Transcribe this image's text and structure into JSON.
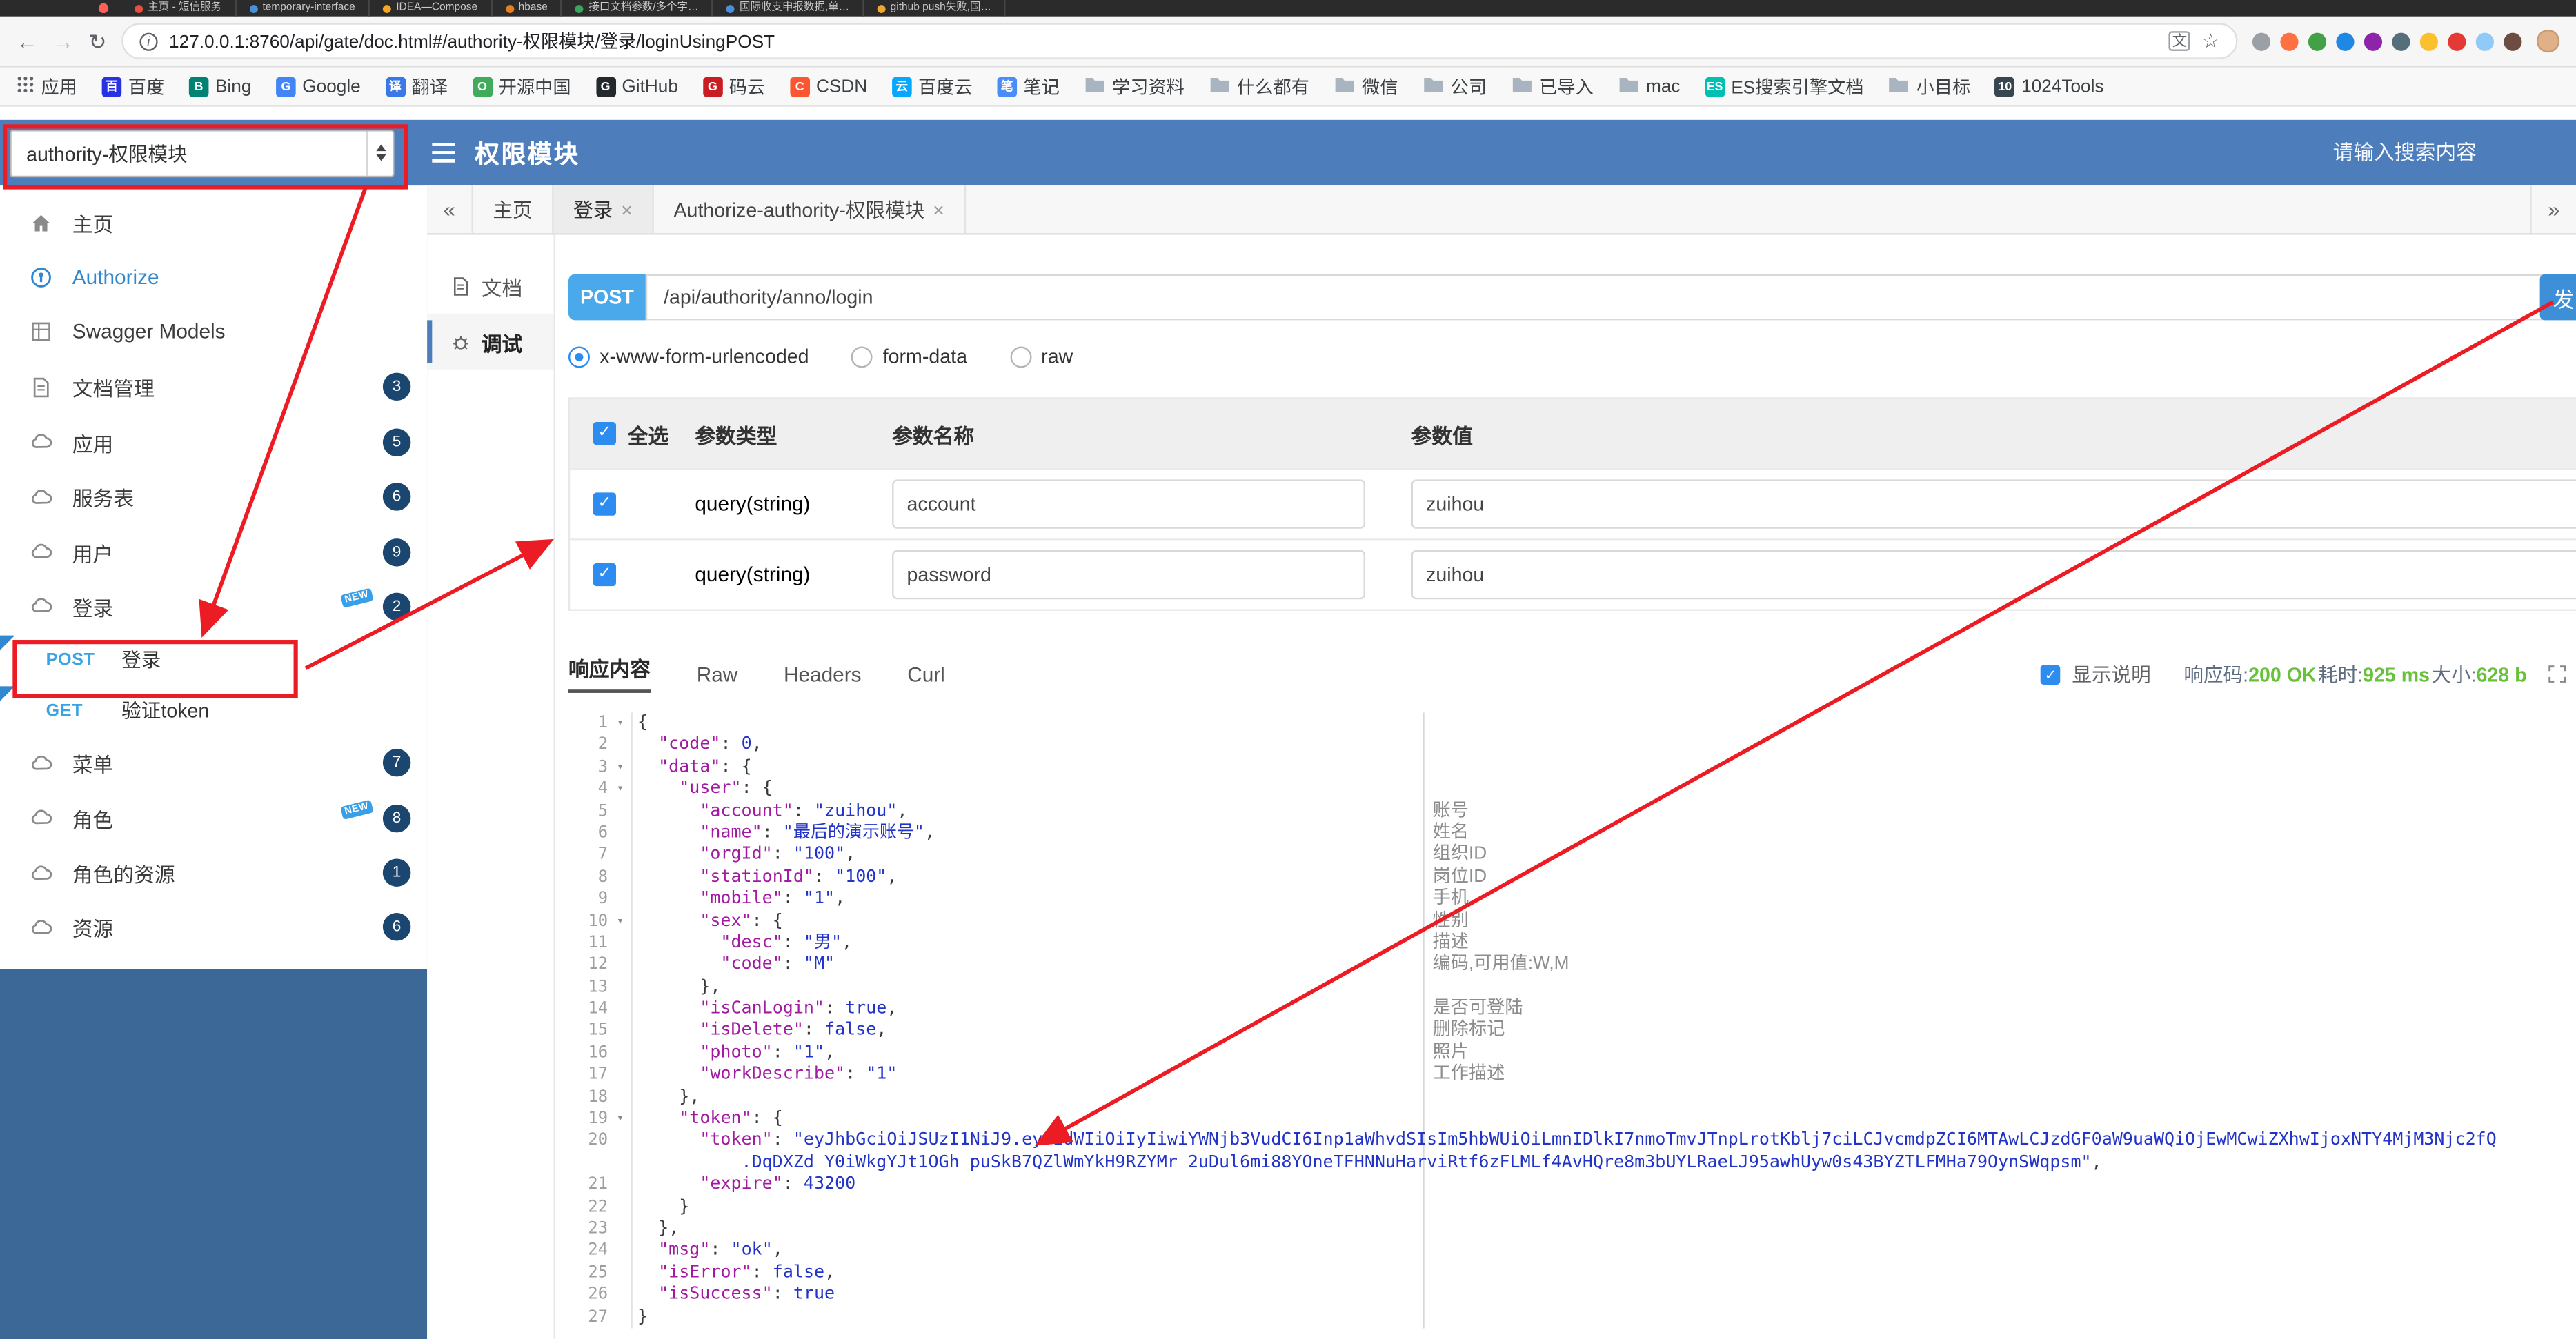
{
  "colors": {
    "header_blue": "#4d7ebb",
    "sidebar_bottom_blue": "#3c6897",
    "accent_blue": "#2d8cf0",
    "method_blue": "#4aa9ea",
    "badge_navy": "#1a466f",
    "success_green": "#67c23a",
    "annotation_red": "#ec1c24"
  },
  "browser": {
    "tabs": [
      {
        "title": "主页 - 短信服务",
        "color": "#e84d3d"
      },
      {
        "title": "temporary-interface",
        "color": "#4a90d9"
      },
      {
        "title": "IDEA—Compose",
        "color": "#f5a623"
      },
      {
        "title": "hbase",
        "color": "#e67e22"
      },
      {
        "title": "接口文档参数/多个字…",
        "color": "#3ba55d"
      },
      {
        "title": "国际收支申报数据,单…",
        "color": "#4a90d9"
      },
      {
        "title": "github push失败,国…",
        "color": "#f0a732"
      }
    ],
    "toolbar": {
      "url": "127.0.0.1:8760/api/gate/doc.html#/authority-权限模块/登录/loginUsingPOST",
      "extension_icons": [
        "#9aa0a6",
        "#ff7043",
        "#43a047",
        "#1e88e5",
        "#8e24aa",
        "#546e7a",
        "#fbc02d",
        "#e53935",
        "#90caf9",
        "#6d4c41"
      ],
      "avatar_color": "#e0b089"
    },
    "bookmarks": [
      {
        "label": "应用",
        "icon": "apps"
      },
      {
        "label": "百度",
        "icon": "letter",
        "letter": "百",
        "color": "#2932e1"
      },
      {
        "label": "Bing",
        "icon": "letter",
        "letter": "B",
        "color": "#008373"
      },
      {
        "label": "Google",
        "icon": "letter",
        "letter": "G",
        "color": "#4285f4"
      },
      {
        "label": "翻译",
        "icon": "letter",
        "letter": "译",
        "color": "#3b78e7"
      },
      {
        "label": "开源中国",
        "icon": "letter",
        "letter": "O",
        "color": "#41ab5d"
      },
      {
        "label": "GitHub",
        "icon": "letter",
        "letter": "G",
        "color": "#24292e"
      },
      {
        "label": "码云",
        "icon": "letter",
        "letter": "G",
        "color": "#c71d23"
      },
      {
        "label": "CSDN",
        "icon": "letter",
        "letter": "C",
        "color": "#fc5531"
      },
      {
        "label": "百度云",
        "icon": "letter",
        "letter": "云",
        "color": "#06a7ff"
      },
      {
        "label": "笔记",
        "icon": "letter",
        "letter": "笔",
        "color": "#4b8df8"
      },
      {
        "label": "学习资料",
        "icon": "folder"
      },
      {
        "label": "什么都有",
        "icon": "folder"
      },
      {
        "label": "微信",
        "icon": "folder"
      },
      {
        "label": "公司",
        "icon": "folder"
      },
      {
        "label": "已导入",
        "icon": "folder"
      },
      {
        "label": "mac",
        "icon": "folder"
      },
      {
        "label": "ES搜索引擎文档",
        "icon": "letter",
        "letter": "ES",
        "color": "#00bfb3"
      },
      {
        "label": "小目标",
        "icon": "folder"
      },
      {
        "label": "1024Tools",
        "icon": "letter",
        "letter": "10",
        "color": "#37474f"
      }
    ]
  },
  "header": {
    "module_select_value": "authority-权限模块",
    "title": "权限模块",
    "search_placeholder": "请输入搜索内容"
  },
  "sidebar": {
    "items": [
      {
        "label": "主页",
        "icon": "home"
      },
      {
        "label": "Authorize",
        "icon": "auth",
        "active": true
      },
      {
        "label": "Swagger Models",
        "icon": "models"
      },
      {
        "label": "文档管理",
        "icon": "doc",
        "badge": "3"
      },
      {
        "label": "应用",
        "icon": "cloud",
        "badge": "5"
      },
      {
        "label": "服务表",
        "icon": "cloud",
        "badge": "6"
      },
      {
        "label": "用户",
        "icon": "cloud",
        "badge": "9"
      },
      {
        "label": "登录",
        "icon": "cloud",
        "badge": "2",
        "is_new": true,
        "children": [
          {
            "method": "POST",
            "label": "登录",
            "highlighted": true
          },
          {
            "method": "GET",
            "label": "验证token"
          }
        ]
      },
      {
        "label": "菜单",
        "icon": "cloud",
        "badge": "7"
      },
      {
        "label": "角色",
        "icon": "cloud",
        "badge": "8",
        "is_new": true
      },
      {
        "label": "角色的资源",
        "icon": "cloud",
        "badge": "1"
      },
      {
        "label": "资源",
        "icon": "cloud",
        "badge": "6"
      }
    ]
  },
  "doc_tabs": {
    "collapse_label": "«",
    "more_label": "»",
    "tabs": [
      {
        "label": "主页",
        "closable": false,
        "active": false
      },
      {
        "label": "登录",
        "closable": true,
        "active": true
      },
      {
        "label": "Authorize-authority-权限模块",
        "closable": true,
        "active": false
      }
    ]
  },
  "vertical_tabs": [
    {
      "label": "文档",
      "active": false
    },
    {
      "label": "调试",
      "active": true
    }
  ],
  "request": {
    "method": "POST",
    "path": "/api/authority/anno/login",
    "send_label": "发送",
    "body_types": [
      {
        "label": "x-www-form-urlencoded",
        "checked": true
      },
      {
        "label": "form-data",
        "checked": false
      },
      {
        "label": "raw",
        "checked": false
      }
    ]
  },
  "params_table": {
    "headers": [
      "全选",
      "参数类型",
      "参数名称",
      "参数值"
    ],
    "rows": [
      {
        "checked": true,
        "type": "query(string)",
        "name": "account",
        "value": "zuihou"
      },
      {
        "checked": true,
        "type": "query(string)",
        "name": "password",
        "value": "zuihou"
      }
    ]
  },
  "response": {
    "tabs": [
      {
        "label": "响应内容",
        "active": true
      },
      {
        "label": "Raw",
        "active": false
      },
      {
        "label": "Headers",
        "active": false
      },
      {
        "label": "Curl",
        "active": false
      }
    ],
    "show_desc_label": "显示说明",
    "show_desc_checked": true,
    "status": [
      {
        "label": "响应码:",
        "value": "200 OK"
      },
      {
        "label": "耗时:",
        "value": "925 ms"
      },
      {
        "label": "大小:",
        "value": "628 b"
      }
    ]
  },
  "code": {
    "rows": [
      {
        "n": "1",
        "fold": true,
        "seg": [
          [
            "pun",
            "{"
          ]
        ]
      },
      {
        "n": "2",
        "seg": [
          [
            "pun",
            "  "
          ],
          [
            "key",
            "\"code\""
          ],
          [
            "pun",
            ": "
          ],
          [
            "num",
            "0"
          ],
          [
            "pun",
            ","
          ]
        ]
      },
      {
        "n": "3",
        "fold": true,
        "seg": [
          [
            "pun",
            "  "
          ],
          [
            "key",
            "\"data\""
          ],
          [
            "pun",
            ": {"
          ]
        ]
      },
      {
        "n": "4",
        "fold": true,
        "seg": [
          [
            "pun",
            "    "
          ],
          [
            "key",
            "\"user\""
          ],
          [
            "pun",
            ": {"
          ]
        ]
      },
      {
        "n": "5",
        "ann": "账号",
        "seg": [
          [
            "pun",
            "      "
          ],
          [
            "key",
            "\"account\""
          ],
          [
            "pun",
            ": "
          ],
          [
            "str",
            "\"zuihou\""
          ],
          [
            "pun",
            ","
          ]
        ]
      },
      {
        "n": "6",
        "ann": "姓名",
        "seg": [
          [
            "pun",
            "      "
          ],
          [
            "key",
            "\"name\""
          ],
          [
            "pun",
            ": "
          ],
          [
            "str",
            "\"最后的演示账号\""
          ],
          [
            "pun",
            ","
          ]
        ]
      },
      {
        "n": "7",
        "ann": "组织ID",
        "seg": [
          [
            "pun",
            "      "
          ],
          [
            "key",
            "\"orgId\""
          ],
          [
            "pun",
            ": "
          ],
          [
            "str",
            "\"100\""
          ],
          [
            "pun",
            ","
          ]
        ]
      },
      {
        "n": "8",
        "ann": "岗位ID",
        "seg": [
          [
            "pun",
            "      "
          ],
          [
            "key",
            "\"stationId\""
          ],
          [
            "pun",
            ": "
          ],
          [
            "str",
            "\"100\""
          ],
          [
            "pun",
            ","
          ]
        ]
      },
      {
        "n": "9",
        "ann": "手机",
        "seg": [
          [
            "pun",
            "      "
          ],
          [
            "key",
            "\"mobile\""
          ],
          [
            "pun",
            ": "
          ],
          [
            "str",
            "\"1\""
          ],
          [
            "pun",
            ","
          ]
        ]
      },
      {
        "n": "10",
        "fold": true,
        "ann": "性别",
        "seg": [
          [
            "pun",
            "      "
          ],
          [
            "key",
            "\"sex\""
          ],
          [
            "pun",
            ": {"
          ]
        ]
      },
      {
        "n": "11",
        "ann": "描述",
        "seg": [
          [
            "pun",
            "        "
          ],
          [
            "key",
            "\"desc\""
          ],
          [
            "pun",
            ": "
          ],
          [
            "str",
            "\"男\""
          ],
          [
            "pun",
            ","
          ]
        ]
      },
      {
        "n": "12",
        "ann": "编码,可用值:W,M",
        "seg": [
          [
            "pun",
            "        "
          ],
          [
            "key",
            "\"code\""
          ],
          [
            "pun",
            ": "
          ],
          [
            "str",
            "\"M\""
          ]
        ]
      },
      {
        "n": "13",
        "seg": [
          [
            "pun",
            "      },"
          ]
        ]
      },
      {
        "n": "14",
        "ann": "是否可登陆",
        "seg": [
          [
            "pun",
            "      "
          ],
          [
            "key",
            "\"isCanLogin\""
          ],
          [
            "pun",
            ": "
          ],
          [
            "bool",
            "true"
          ],
          [
            "pun",
            ","
          ]
        ]
      },
      {
        "n": "15",
        "ann": "删除标记",
        "seg": [
          [
            "pun",
            "      "
          ],
          [
            "key",
            "\"isDelete\""
          ],
          [
            "pun",
            ": "
          ],
          [
            "bool",
            "false"
          ],
          [
            "pun",
            ","
          ]
        ]
      },
      {
        "n": "16",
        "ann": "照片",
        "seg": [
          [
            "pun",
            "      "
          ],
          [
            "key",
            "\"photo\""
          ],
          [
            "pun",
            ": "
          ],
          [
            "str",
            "\"1\""
          ],
          [
            "pun",
            ","
          ]
        ]
      },
      {
        "n": "17",
        "ann": "工作描述",
        "seg": [
          [
            "pun",
            "      "
          ],
          [
            "key",
            "\"workDescribe\""
          ],
          [
            "pun",
            ": "
          ],
          [
            "str",
            "\"1\""
          ]
        ]
      },
      {
        "n": "18",
        "seg": [
          [
            "pun",
            "    },"
          ]
        ]
      },
      {
        "n": "19",
        "fold": true,
        "seg": [
          [
            "pun",
            "    "
          ],
          [
            "key",
            "\"token\""
          ],
          [
            "pun",
            ": {"
          ]
        ]
      },
      {
        "n": "20",
        "seg": [
          [
            "pun",
            "      "
          ],
          [
            "key",
            "\"token\""
          ],
          [
            "pun",
            ": "
          ],
          [
            "str",
            "\"eyJhbGciOiJSUzI1NiJ9.eyJzdWIiOiIyIiwiYWNjb3VudCI6Inp1aWhvdSIsIm5hbWUiOiLmnIDlkI7nmoTmvJTnpLrotKblj7ciLCJvcmdpZCI6MTAwLCJzdGF0aW9uaWQiOjEwMCwiZXhwIjoxNTY4MjM3Njc2fQ"
          ]
        ]
      },
      {
        "n": "",
        "seg": [
          [
            "str",
            "          .DqDXZd_Y0iWkgYJt1OGh_puSkB7QZlWmYkH9RZYMr_2uDul6mi88YOneTFHNNuHarviRtf6zFLMLf4AvHQre8m3bUYLRaeLJ95awhUyw0s43BYZTLFMHa79OynSWqpsm\""
          ],
          [
            "pun",
            ","
          ]
        ]
      },
      {
        "n": "21",
        "seg": [
          [
            "pun",
            "      "
          ],
          [
            "key",
            "\"expire\""
          ],
          [
            "pun",
            ": "
          ],
          [
            "num",
            "43200"
          ]
        ]
      },
      {
        "n": "22",
        "seg": [
          [
            "pun",
            "    }"
          ]
        ]
      },
      {
        "n": "23",
        "seg": [
          [
            "pun",
            "  },"
          ]
        ]
      },
      {
        "n": "24",
        "seg": [
          [
            "pun",
            "  "
          ],
          [
            "key",
            "\"msg\""
          ],
          [
            "pun",
            ": "
          ],
          [
            "str",
            "\"ok\""
          ],
          [
            "pun",
            ","
          ]
        ]
      },
      {
        "n": "25",
        "seg": [
          [
            "pun",
            "  "
          ],
          [
            "key",
            "\"isError\""
          ],
          [
            "pun",
            ": "
          ],
          [
            "bool",
            "false"
          ],
          [
            "pun",
            ","
          ]
        ]
      },
      {
        "n": "26",
        "seg": [
          [
            "pun",
            "  "
          ],
          [
            "key",
            "\"isSuccess\""
          ],
          [
            "pun",
            ": "
          ],
          [
            "bool",
            "true"
          ]
        ]
      },
      {
        "n": "27",
        "seg": [
          [
            "pun",
            "}"
          ]
        ]
      }
    ]
  }
}
